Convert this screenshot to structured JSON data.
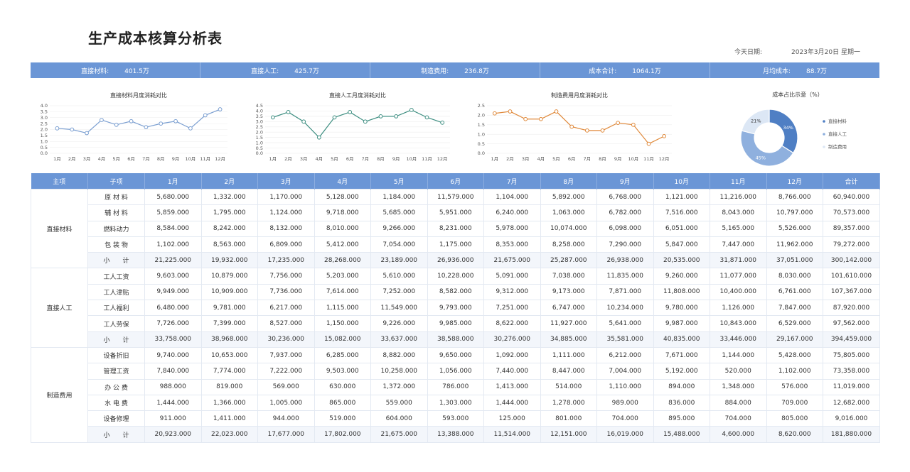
{
  "title": "生产成本核算分析表",
  "date_label": "今天日期:",
  "date_value": "2023年3月20日 星期一",
  "summary": [
    {
      "label": "直接材料:",
      "value": "401.5万"
    },
    {
      "label": "直接人工:",
      "value": "425.7万"
    },
    {
      "label": "制造费用:",
      "value": "236.8万"
    },
    {
      "label": "成本合计:",
      "value": "1064.1万"
    },
    {
      "label": "月均成本:",
      "value": "88.7万"
    }
  ],
  "chart_data": [
    {
      "type": "line",
      "title": "直接材料月度消耗对比",
      "categories": [
        "1月",
        "2月",
        "3月",
        "4月",
        "5月",
        "6月",
        "7月",
        "8月",
        "9月",
        "10月",
        "11月",
        "12月"
      ],
      "series": [
        {
          "values": [
            2.1,
            2.0,
            1.7,
            2.8,
            2.4,
            2.7,
            2.2,
            2.5,
            2.7,
            2.1,
            3.2,
            3.7
          ]
        }
      ],
      "ylim": [
        0,
        4.0
      ],
      "yticks": [
        "0.0",
        "0.5",
        "1.0",
        "1.5",
        "2.0",
        "2.5",
        "3.0",
        "3.5",
        "4.0"
      ],
      "color": "#7b9fd1"
    },
    {
      "type": "line",
      "title": "直接人工月度消耗对比",
      "categories": [
        "1月",
        "2月",
        "3月",
        "4月",
        "5月",
        "6月",
        "7月",
        "8月",
        "9月",
        "10月",
        "11月",
        "12月"
      ],
      "series": [
        {
          "values": [
            3.4,
            3.9,
            3.0,
            1.5,
            3.4,
            3.9,
            3.0,
            3.5,
            3.5,
            4.1,
            3.4,
            2.9
          ]
        }
      ],
      "ylim": [
        0,
        4.5
      ],
      "yticks": [
        "0.0",
        "0.5",
        "1.0",
        "1.5",
        "2.0",
        "2.5",
        "3.0",
        "3.5",
        "4.0",
        "4.5"
      ],
      "color": "#3f8f82"
    },
    {
      "type": "line",
      "title": "制造费用月度消耗对比",
      "categories": [
        "1月",
        "2月",
        "3月",
        "4月",
        "5月",
        "6月",
        "7月",
        "8月",
        "9月",
        "10月",
        "11月",
        "12月"
      ],
      "series": [
        {
          "values": [
            2.1,
            2.2,
            1.8,
            1.8,
            2.2,
            1.4,
            1.2,
            1.2,
            1.6,
            1.5,
            0.5,
            0.9
          ]
        }
      ],
      "ylim": [
        0,
        2.5
      ],
      "yticks": [
        "0.0",
        "0.5",
        "1.0",
        "1.5",
        "2.0",
        "2.5"
      ],
      "color": "#e08a3c"
    },
    {
      "type": "pie",
      "title": "成本占比示意（%）",
      "categories": [
        "直接材料",
        "直接人工",
        "制造费用"
      ],
      "values": [
        34,
        45,
        21
      ],
      "labels": [
        "34%",
        "45%",
        "21%"
      ],
      "colors": [
        "#4f7fc4",
        "#8fb0de",
        "#dce7f5"
      ]
    }
  ],
  "table": {
    "headers": [
      "主项",
      "子项",
      "1月",
      "2月",
      "3月",
      "4月",
      "5月",
      "6月",
      "7月",
      "8月",
      "9月",
      "10月",
      "11月",
      "12月",
      "合计"
    ],
    "groups": [
      {
        "name": "直接材料",
        "rows": [
          {
            "sub": "原 材 料",
            "values": [
              "5,680.000",
              "1,332.000",
              "1,170.000",
              "5,128.000",
              "1,184.000",
              "11,579.000",
              "1,104.000",
              "5,892.000",
              "6,768.000",
              "1,121.000",
              "11,216.000",
              "8,766.000",
              "60,940.000"
            ]
          },
          {
            "sub": "辅 材 料",
            "values": [
              "5,859.000",
              "1,795.000",
              "1,124.000",
              "9,718.000",
              "5,685.000",
              "5,951.000",
              "6,240.000",
              "1,063.000",
              "6,782.000",
              "7,516.000",
              "8,043.000",
              "10,797.000",
              "70,573.000"
            ]
          },
          {
            "sub": "燃料动力",
            "values": [
              "8,584.000",
              "8,242.000",
              "8,132.000",
              "8,010.000",
              "9,266.000",
              "8,231.000",
              "5,978.000",
              "10,074.000",
              "6,098.000",
              "6,051.000",
              "5,165.000",
              "5,526.000",
              "89,357.000"
            ]
          },
          {
            "sub": "包 装 物",
            "values": [
              "1,102.000",
              "8,563.000",
              "6,809.000",
              "5,412.000",
              "7,054.000",
              "1,175.000",
              "8,353.000",
              "8,258.000",
              "7,290.000",
              "5,847.000",
              "7,447.000",
              "11,962.000",
              "79,272.000"
            ]
          },
          {
            "sub": "小　　计",
            "subtotal": true,
            "values": [
              "21,225.000",
              "19,932.000",
              "17,235.000",
              "28,268.000",
              "23,189.000",
              "26,936.000",
              "21,675.000",
              "25,287.000",
              "26,938.000",
              "20,535.000",
              "31,871.000",
              "37,051.000",
              "300,142.000"
            ]
          }
        ]
      },
      {
        "name": "直接人工",
        "rows": [
          {
            "sub": "工人工资",
            "values": [
              "9,603.000",
              "10,879.000",
              "7,756.000",
              "5,203.000",
              "5,610.000",
              "10,228.000",
              "5,091.000",
              "7,038.000",
              "11,835.000",
              "9,260.000",
              "11,077.000",
              "8,030.000",
              "101,610.000"
            ]
          },
          {
            "sub": "工人津贴",
            "values": [
              "9,949.000",
              "10,909.000",
              "7,736.000",
              "7,614.000",
              "7,252.000",
              "8,582.000",
              "9,312.000",
              "9,173.000",
              "7,871.000",
              "11,808.000",
              "10,400.000",
              "6,761.000",
              "107,367.000"
            ]
          },
          {
            "sub": "工人福利",
            "values": [
              "6,480.000",
              "9,781.000",
              "6,217.000",
              "1,115.000",
              "11,549.000",
              "9,793.000",
              "7,251.000",
              "6,747.000",
              "10,234.000",
              "9,780.000",
              "1,126.000",
              "7,847.000",
              "87,920.000"
            ]
          },
          {
            "sub": "工人劳保",
            "values": [
              "7,726.000",
              "7,399.000",
              "8,527.000",
              "1,150.000",
              "9,226.000",
              "9,985.000",
              "8,622.000",
              "11,927.000",
              "5,641.000",
              "9,987.000",
              "10,843.000",
              "6,529.000",
              "97,562.000"
            ]
          },
          {
            "sub": "小　　计",
            "subtotal": true,
            "values": [
              "33,758.000",
              "38,968.000",
              "30,236.000",
              "15,082.000",
              "33,637.000",
              "38,588.000",
              "30,276.000",
              "34,885.000",
              "35,581.000",
              "40,835.000",
              "33,446.000",
              "29,167.000",
              "394,459.000"
            ]
          }
        ]
      },
      {
        "name": "制造费用",
        "rows": [
          {
            "sub": "设备折旧",
            "values": [
              "9,740.000",
              "10,653.000",
              "7,937.000",
              "6,285.000",
              "8,882.000",
              "9,650.000",
              "1,092.000",
              "1,111.000",
              "6,212.000",
              "7,671.000",
              "1,144.000",
              "5,428.000",
              "75,805.000"
            ]
          },
          {
            "sub": "管理工资",
            "values": [
              "7,840.000",
              "7,774.000",
              "7,222.000",
              "9,503.000",
              "10,258.000",
              "1,056.000",
              "7,440.000",
              "8,447.000",
              "7,004.000",
              "5,192.000",
              "520.000",
              "1,102.000",
              "73,358.000"
            ]
          },
          {
            "sub": "办 公 费",
            "values": [
              "988.000",
              "819.000",
              "569.000",
              "630.000",
              "1,372.000",
              "786.000",
              "1,413.000",
              "514.000",
              "1,110.000",
              "894.000",
              "1,348.000",
              "576.000",
              "11,019.000"
            ]
          },
          {
            "sub": "水 电 费",
            "values": [
              "1,444.000",
              "1,366.000",
              "1,005.000",
              "865.000",
              "559.000",
              "1,303.000",
              "1,444.000",
              "1,278.000",
              "989.000",
              "836.000",
              "884.000",
              "709.000",
              "12,682.000"
            ]
          },
          {
            "sub": "设备修理",
            "values": [
              "911.000",
              "1,411.000",
              "944.000",
              "519.000",
              "604.000",
              "593.000",
              "125.000",
              "801.000",
              "704.000",
              "895.000",
              "704.000",
              "805.000",
              "9,016.000"
            ]
          },
          {
            "sub": "小　　计",
            "subtotal": true,
            "values": [
              "20,923.000",
              "22,023.000",
              "17,677.000",
              "17,802.000",
              "21,675.000",
              "13,388.000",
              "11,514.000",
              "12,151.000",
              "16,019.000",
              "15,488.000",
              "4,600.000",
              "8,620.000",
              "181,880.000"
            ]
          }
        ]
      }
    ]
  }
}
